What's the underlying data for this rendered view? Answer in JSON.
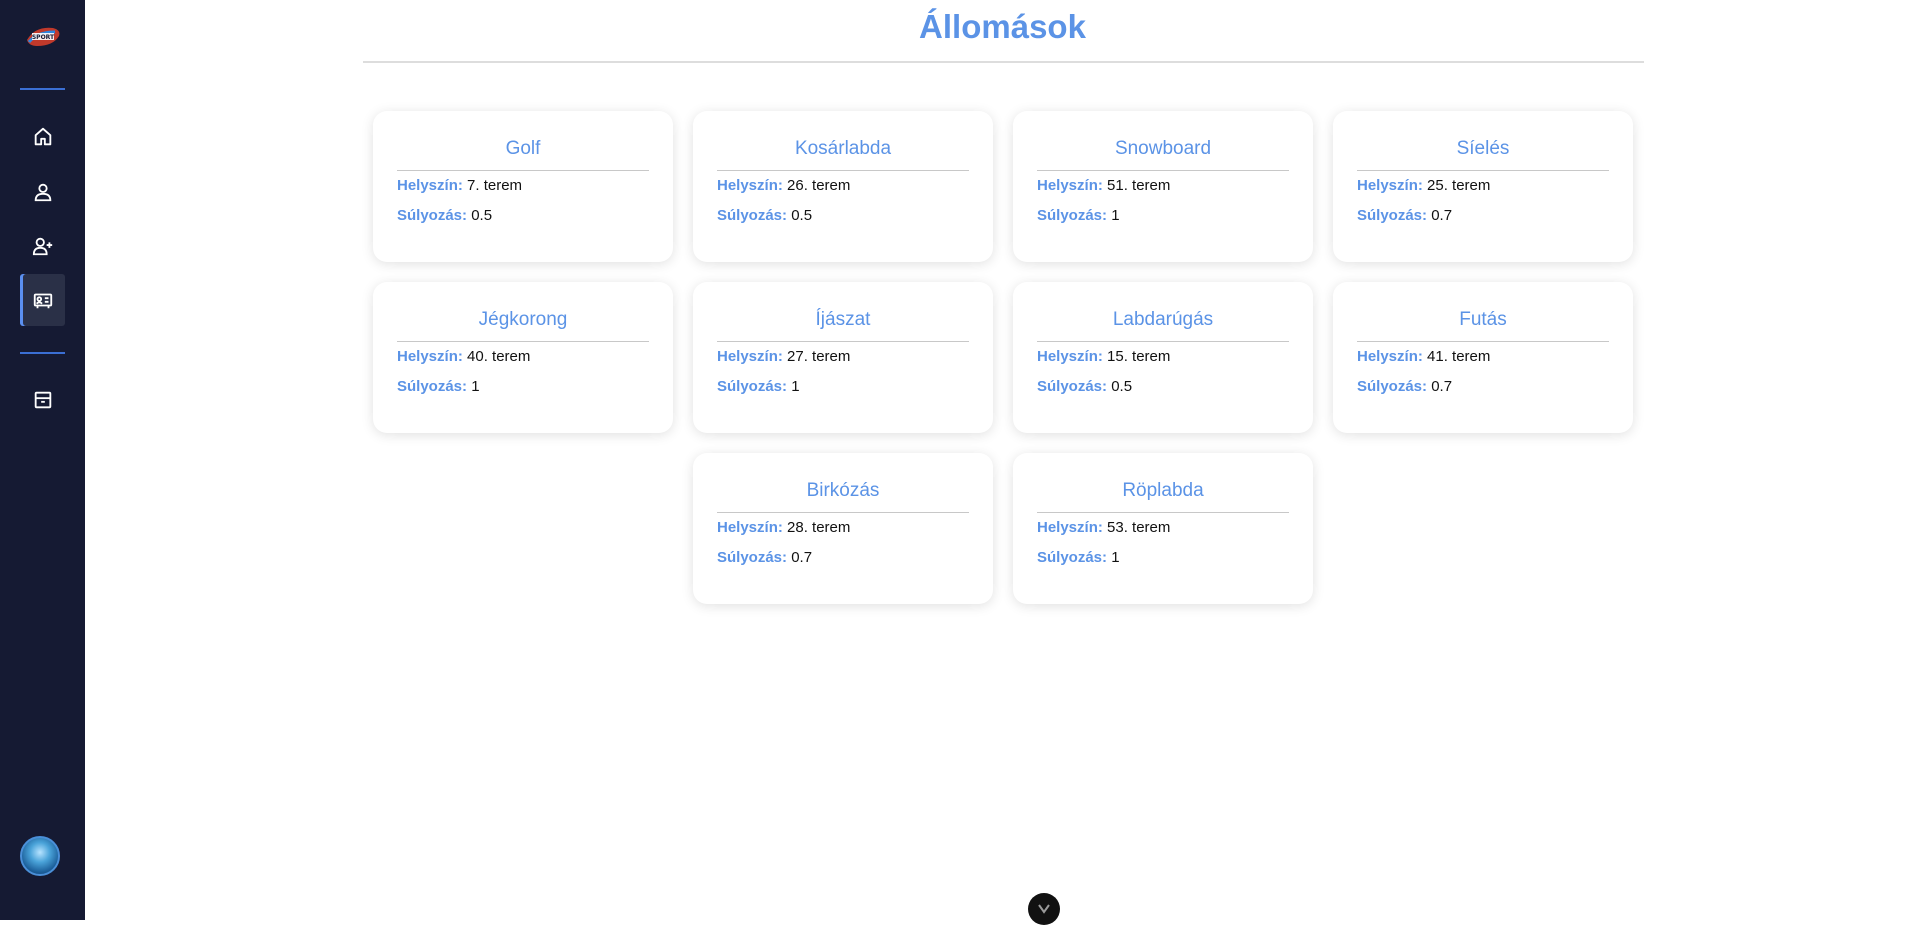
{
  "page": {
    "title": "Állomások",
    "location_label": "Helyszín:",
    "weight_label": "Súlyozás:"
  },
  "sidebar": {
    "logo_text": "SPORT",
    "items": [
      {
        "icon": "home-icon"
      },
      {
        "icon": "user-icon"
      },
      {
        "icon": "user-add-icon"
      },
      {
        "icon": "stations-icon",
        "active": true
      },
      {
        "icon": "archive-icon"
      }
    ]
  },
  "colors": {
    "accent": "#5b93e6",
    "sidebar_bg": "#151a33",
    "divider": "#3b6fd4"
  },
  "stations": [
    {
      "name": "Golf",
      "location": "7. terem",
      "weight": "0.5"
    },
    {
      "name": "Kosárlabda",
      "location": "26. terem",
      "weight": "0.5"
    },
    {
      "name": "Snowboard",
      "location": "51. terem",
      "weight": "1"
    },
    {
      "name": "Síelés",
      "location": "25. terem",
      "weight": "0.7"
    },
    {
      "name": "Jégkorong",
      "location": "40. terem",
      "weight": "1"
    },
    {
      "name": "Íjászat",
      "location": "27. terem",
      "weight": "1"
    },
    {
      "name": "Labdarúgás",
      "location": "15. terem",
      "weight": "0.5"
    },
    {
      "name": "Futás",
      "location": "41. terem",
      "weight": "0.7"
    },
    {
      "name": "Birkózás",
      "location": "28. terem",
      "weight": "0.7"
    },
    {
      "name": "Röplabda",
      "location": "53. terem",
      "weight": "1"
    }
  ]
}
